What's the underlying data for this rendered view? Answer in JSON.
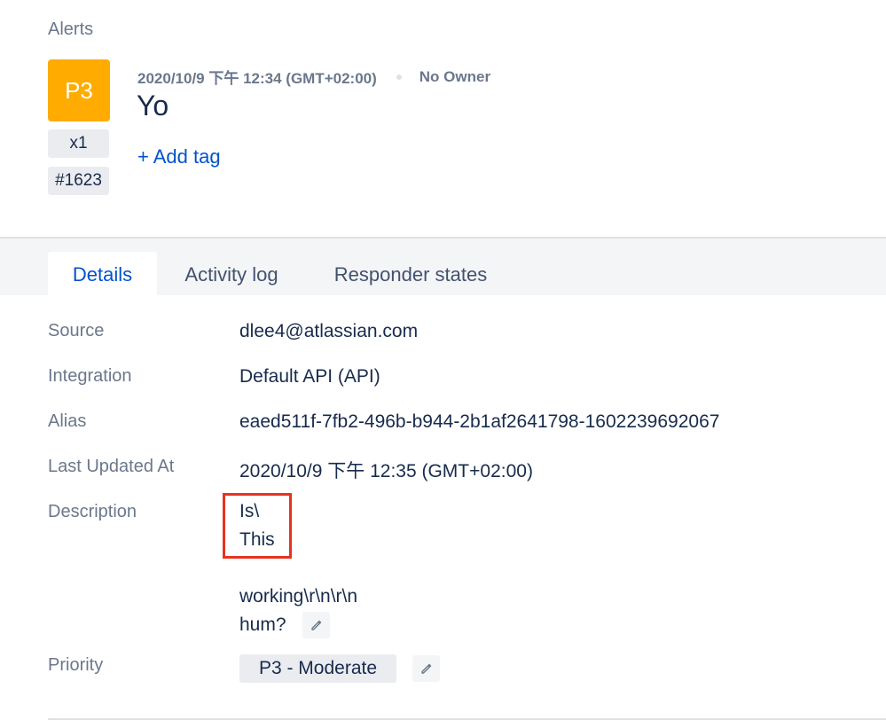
{
  "breadcrumb": "Alerts",
  "alert": {
    "priority": "P3",
    "priority_color": "#ffab00",
    "count": "x1",
    "tiny_id": "#1623",
    "created": "2020/10/9 下午 12:34 (GMT+02:00)",
    "owner": "No Owner",
    "title": "Yo",
    "add_tag": "+ Add tag"
  },
  "tabs": [
    {
      "label": "Details",
      "active": true
    },
    {
      "label": "Activity log",
      "active": false
    },
    {
      "label": "Responder states",
      "active": false
    }
  ],
  "details": {
    "source_label": "Source",
    "source": "dlee4@atlassian.com",
    "integration_label": "Integration",
    "integration": "Default API (API)",
    "alias_label": "Alias",
    "alias": "eaed511f-7fb2-496b-b944-2b1af2641798-1602239692067",
    "updated_label": "Last Updated At",
    "updated": "2020/10/9 下午 12:35 (GMT+02:00)",
    "description_label": "Description",
    "description_lines": [
      "Is\\",
      "This",
      "",
      "working\\r\\n\\r\\n",
      "hum?"
    ],
    "priority_label": "Priority",
    "priority": "P3 - Moderate"
  },
  "icons": {
    "edit_description": "pencil-icon",
    "edit_priority": "pencil-icon"
  }
}
